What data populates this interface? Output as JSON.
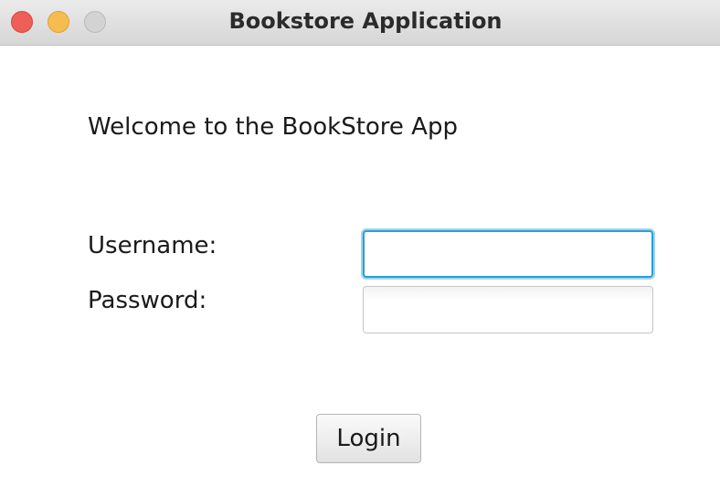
{
  "window": {
    "title": "Bookstore Application",
    "controls": {
      "close_color": "#ee5f57",
      "minimize_color": "#f5bd4f",
      "zoom_color": "#d3d3d3"
    }
  },
  "main": {
    "welcome_text": "Welcome to the BookStore App",
    "username_label": "Username:",
    "username_value": "",
    "password_label": "Password:",
    "password_value": "",
    "login_label": "Login",
    "focus_color": "#2a9fd6"
  }
}
